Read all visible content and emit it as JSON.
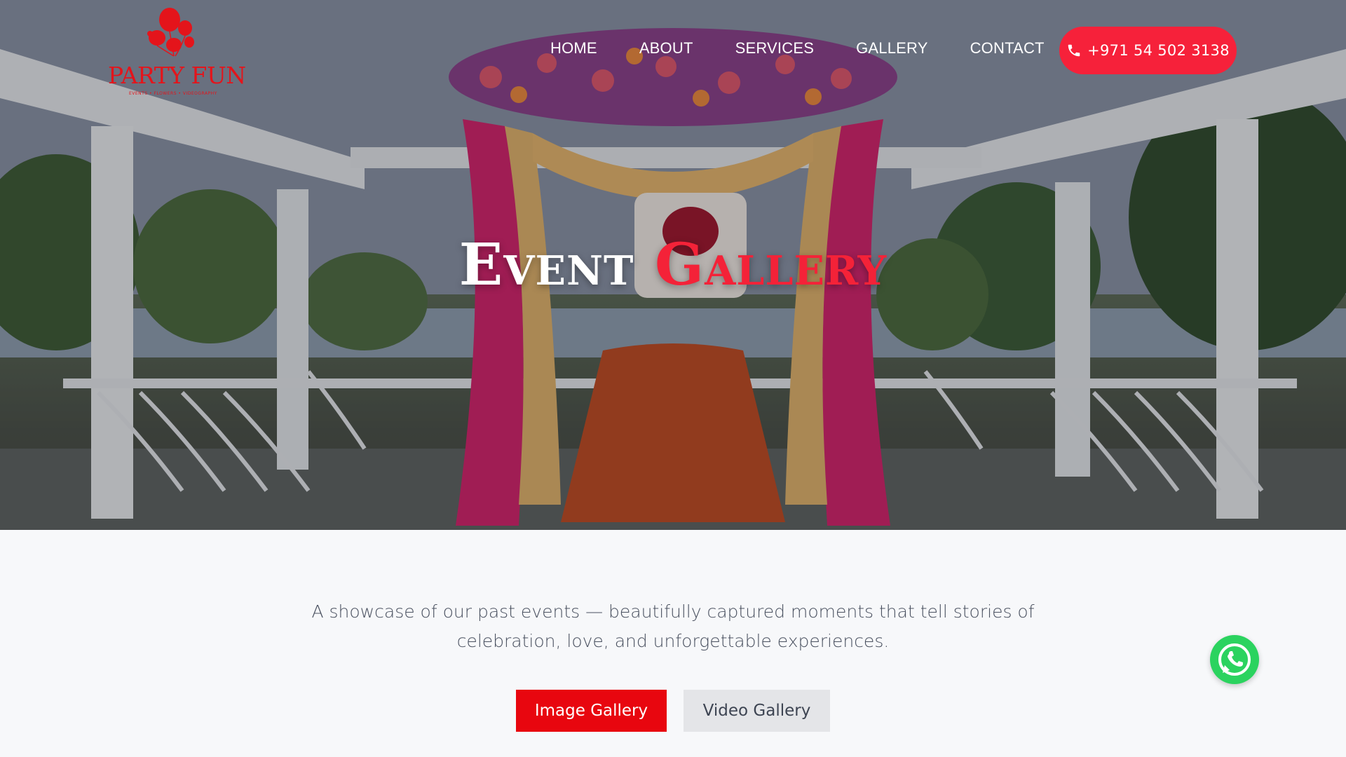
{
  "brand": {
    "name": "PARTY FUN",
    "tagline": "EVENTS • FLOWERS • VIDEOGRAPHY",
    "color": "#e4141b"
  },
  "nav": {
    "items": [
      {
        "label": "HOME"
      },
      {
        "label": "ABOUT"
      },
      {
        "label": "SERVICES"
      },
      {
        "label": "GALLERY"
      },
      {
        "label": "CONTACT"
      }
    ],
    "phone": "+971 54 502 3138",
    "phone_icon": "phone-icon"
  },
  "hero": {
    "title_word1": "Event",
    "title_word2": "Gallery",
    "accent": "#f42238"
  },
  "intro": {
    "text": "A showcase of our past events — beautifully captured moments that tell stories of celebration, love, and unforgettable experiences."
  },
  "tabs": {
    "image_label": "Image Gallery",
    "video_label": "Video Gallery",
    "active": "Image Gallery"
  },
  "floating": {
    "whatsapp_icon": "whatsapp-icon",
    "color": "#2bd35f"
  }
}
